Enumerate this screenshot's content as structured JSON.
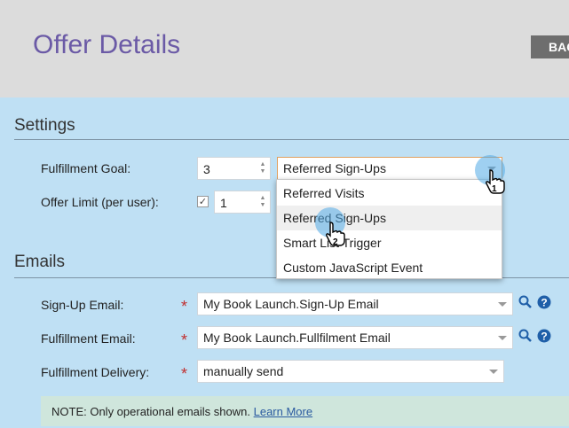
{
  "header": {
    "title": "Offer Details",
    "back_label": "BACK"
  },
  "settings": {
    "title": "Settings",
    "fulfillment_goal_label": "Fulfillment Goal:",
    "fulfillment_goal_value": "3",
    "fulfillment_goal_select": "Referred Sign-Ups",
    "offer_limit_label": "Offer Limit (per user):",
    "offer_limit_value": "1",
    "offer_limit_checked": true
  },
  "dropdown": {
    "options": [
      "Referred Visits",
      "Referred Sign-Ups",
      "Smart List Trigger",
      "Custom JavaScript Event"
    ],
    "highlighted_index": 1
  },
  "emails": {
    "title": "Emails",
    "signup_label": "Sign-Up Email:",
    "signup_value": "My Book Launch.Sign-Up Email",
    "fulfillment_label": "Fulfillment Email:",
    "fulfillment_value": "My Book Launch.Fullfilment Email",
    "delivery_label": "Fulfillment Delivery:",
    "delivery_value": "manually send",
    "required_mark": "*"
  },
  "note": {
    "prefix": "NOTE:  Only operational emails shown.",
    "link": "Learn More"
  },
  "cursors": {
    "step1": "1",
    "step2": "2"
  },
  "colors": {
    "title": "#6b5aa6",
    "required": "#c03030",
    "icon_blue": "#1f5fa8"
  }
}
